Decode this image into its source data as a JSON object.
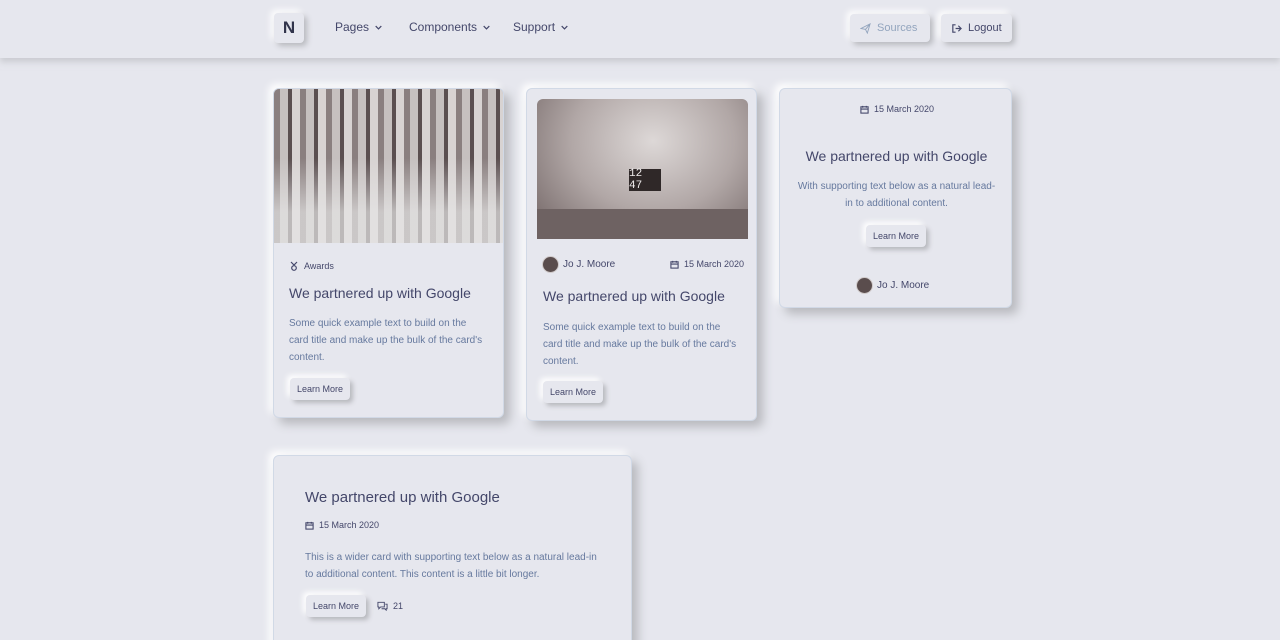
{
  "nav": {
    "brand": "N",
    "links": [
      {
        "label": "Pages"
      },
      {
        "label": "Components"
      },
      {
        "label": "Support"
      }
    ],
    "sources_label": "Sources",
    "logout_label": "Logout"
  },
  "card1": {
    "badge": "Awards",
    "title": "We partnered up with Google",
    "text": "Some quick example text to build on the card title and make up the bulk of the card's content.",
    "button": "Learn More"
  },
  "card2": {
    "photo_clock": "12 47",
    "author": "Jo J. Moore",
    "date": "15 March 2020",
    "title": "We partnered up with Google",
    "text": "Some quick example text to build on the card title and make up the bulk of the card's content.",
    "button": "Learn More"
  },
  "card3": {
    "date": "15 March 2020",
    "title": "We partnered up with Google",
    "text": "With supporting text below as a natural lead-in to additional content.",
    "button": "Learn More",
    "author": "Jo J. Moore"
  },
  "card4": {
    "title": "We partnered up with Google",
    "date": "15 March 2020",
    "text": "This is a wider card with supporting text below as a natural lead-in to additional content. This content is a little bit longer.",
    "button": "Learn More",
    "comments": "21"
  }
}
